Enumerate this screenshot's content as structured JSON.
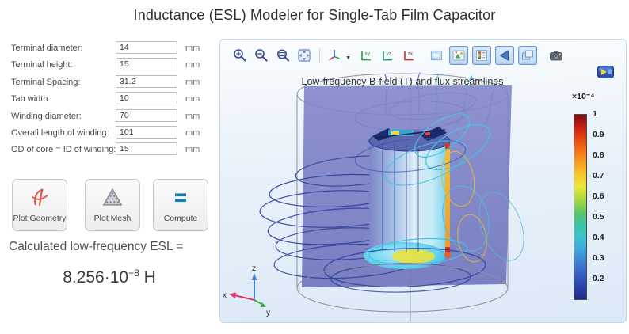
{
  "title": "Inductance (ESL) Modeler for Single-Tab Film Capacitor",
  "form": {
    "fields": [
      {
        "label": "Terminal diameter:",
        "value": "14",
        "unit": "mm"
      },
      {
        "label": "Terminal height:",
        "value": "15",
        "unit": "mm"
      },
      {
        "label": "Terminal Spacing:",
        "value": "31.2",
        "unit": "mm"
      },
      {
        "label": "Tab width:",
        "value": "10",
        "unit": "mm"
      },
      {
        "label": "Winding diameter:",
        "value": "70",
        "unit": "mm"
      },
      {
        "label": "Overall length of winding:",
        "value": "101",
        "unit": "mm"
      },
      {
        "label": "OD of core = ID of winding:",
        "value": "15",
        "unit": "mm"
      }
    ]
  },
  "actions": {
    "plot_geometry": {
      "label": "Plot Geometry",
      "icon": "compass-icon"
    },
    "plot_mesh": {
      "label": "Plot Mesh",
      "icon": "mesh-triangle-icon"
    },
    "compute": {
      "label": "Compute",
      "icon": "equals-icon"
    }
  },
  "result": {
    "label": "Calculated low-frequency ESL =",
    "mantissa": "8.256·10",
    "exponent": "−8",
    "unit": "H"
  },
  "graphics": {
    "toolbar": {
      "icons": [
        {
          "name": "zoom-in-icon",
          "pressed": false
        },
        {
          "name": "zoom-out-icon",
          "pressed": false
        },
        {
          "name": "zoom-box-icon",
          "pressed": false
        },
        {
          "name": "zoom-extents-icon",
          "pressed": false
        },
        {
          "name": "default-3d-view-icon",
          "pressed": false
        },
        {
          "name": "view-xy-icon",
          "pressed": false
        },
        {
          "name": "view-yz-icon",
          "pressed": false
        },
        {
          "name": "view-zx-icon",
          "pressed": false
        },
        {
          "name": "show-grid-icon",
          "pressed": false
        },
        {
          "name": "scene-light-icon",
          "pressed": true
        },
        {
          "name": "color-legend-icon",
          "pressed": true
        },
        {
          "name": "select-arrow-icon",
          "pressed": true
        },
        {
          "name": "transparency-icon",
          "pressed": true
        },
        {
          "name": "snapshot-camera-icon",
          "pressed": false
        }
      ]
    },
    "plot_title": "Low-frequency B-field (T) and flux streamlines",
    "colorbar": {
      "multiplier": "×10⁻⁴",
      "ticks": [
        "1",
        "0.9",
        "0.8",
        "0.7",
        "0.6",
        "0.5",
        "0.4",
        "0.3",
        "0.2"
      ]
    },
    "triad": {
      "x": "x",
      "y": "y",
      "z": "z"
    }
  },
  "colors": {
    "compute_teal": "#1a7fa8",
    "compass_red": "#e2574c",
    "plane_purple": "#7a7ec4",
    "panel_border": "#c3d5e8",
    "toolbar_pressed_border": "#6b9bd2"
  }
}
